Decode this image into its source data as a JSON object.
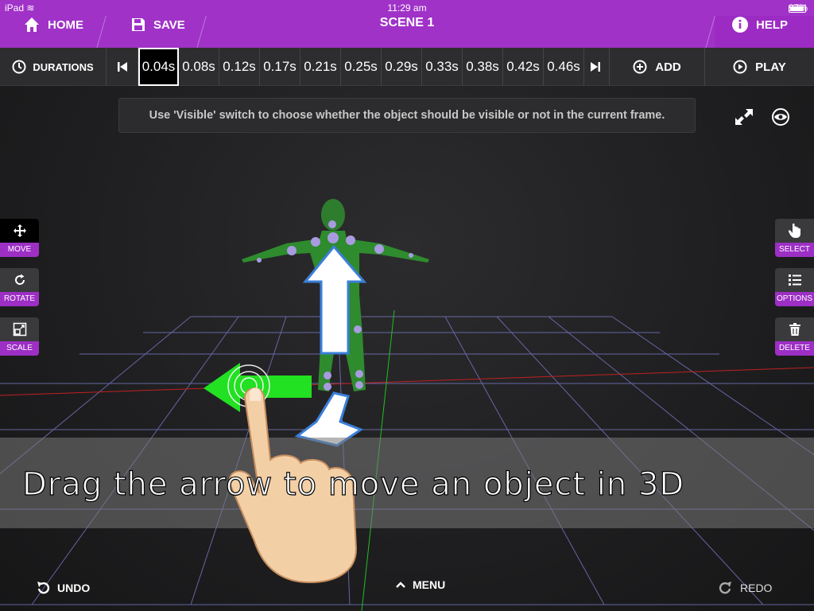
{
  "status": {
    "device": "iPad",
    "time": "11:29 am",
    "battery": "97%"
  },
  "nav": {
    "home": "HOME",
    "save": "SAVE",
    "title": "SCENE 1",
    "help": "HELP"
  },
  "timeline": {
    "durations": "DURATIONS",
    "frames": [
      "0.04s",
      "0.08s",
      "0.12s",
      "0.17s",
      "0.21s",
      "0.25s",
      "0.29s",
      "0.33s",
      "0.38s",
      "0.42s",
      "0.46s"
    ],
    "active_frame": "0.04s",
    "add": "ADD",
    "play": "PLAY"
  },
  "hint": "Use 'Visible' switch to choose whether the object should be visible or not in the current frame.",
  "tools_left": [
    {
      "label": "MOVE",
      "icon": "move-icon",
      "active": true
    },
    {
      "label": "ROTATE",
      "icon": "rotate-icon",
      "active": false
    },
    {
      "label": "SCALE",
      "icon": "scale-icon",
      "active": false
    }
  ],
  "tools_right": [
    {
      "label": "SELECT",
      "icon": "hand-icon"
    },
    {
      "label": "OPTIONS",
      "icon": "list-icon"
    },
    {
      "label": "DELETE",
      "icon": "trash-icon"
    }
  ],
  "tutorial": "Drag the arrow to move an object in 3D",
  "bottom": {
    "undo": "UNDO",
    "menu": "MENU",
    "redo": "REDO"
  },
  "colors": {
    "accent": "#a032c8",
    "figure": "#2e8b2e",
    "joint": "#a89be0",
    "arrow_green": "#22e022"
  }
}
